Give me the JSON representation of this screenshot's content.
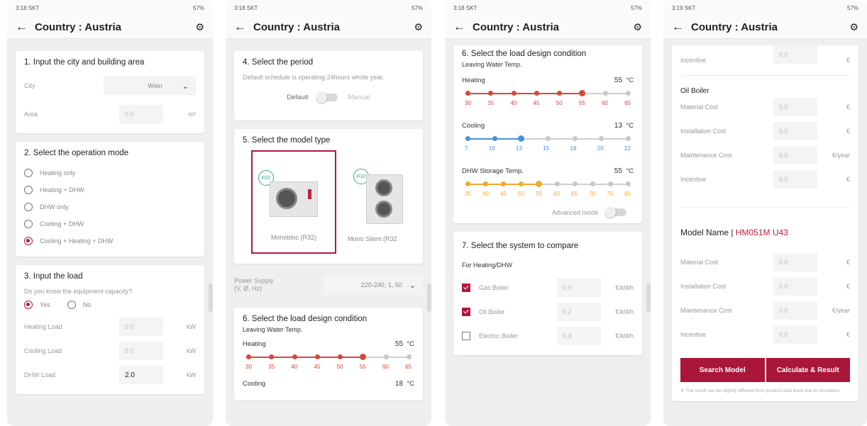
{
  "header": {
    "title": "Country : Austria"
  },
  "status": {
    "s1": "3:18 SKT",
    "s2": "3:18 SKT",
    "s3": "3:18 SKT",
    "s4": "3:19 SKT",
    "right": "57%"
  },
  "p1": {
    "sec1": {
      "title": "1. Input the city and building area",
      "city_label": "City",
      "city_value": "Wien",
      "area_label": "Area",
      "area_value": "0.0",
      "area_unit": "m²"
    },
    "sec2": {
      "title": "2. Select the operation mode",
      "options": [
        "Heating only",
        "Heating + DHW",
        "DHW only",
        "Cooling + DHW",
        "Cooling + Heating + DHW"
      ]
    },
    "sec3": {
      "title": "3. Input the load",
      "question": "Do you know the equipment capacity?",
      "yes": "Yes",
      "no": "No",
      "heating_label": "Heating Load",
      "heating_value": "0.0",
      "unit": "kW",
      "cooling_label": "Cooling Load",
      "cooling_value": "0.0",
      "dhw_label": "DHW Load",
      "dhw_value": "2.0"
    }
  },
  "p2": {
    "sec4": {
      "title": "4. Select the period",
      "desc": "Default schedule is operating 24hours whole year.",
      "default": "Default",
      "manual": "Manual"
    },
    "sec5": {
      "title": "5. Select the model type",
      "badge": "R32",
      "model1": "Monobloc (R32)",
      "model2": "Mono Silent (R32",
      "power_label1": "Power Supply",
      "power_label2": "(V, Ø, Hz)",
      "power_value": "220-240, 1, 50"
    },
    "sec6": {
      "title": "6. Select the load design condition",
      "sub": "Leaving Water Temp.",
      "heating": "Heating",
      "heating_val": "55",
      "unit": "°C",
      "cooling": "Cooling",
      "cooling_val": "18"
    }
  },
  "p3": {
    "sec6": {
      "title": "6. Select the load design condition",
      "sub": "Leaving Water Temp.",
      "heating": "Heating",
      "heating_val": "55",
      "cooling": "Cooling",
      "cooling_val": "13",
      "dhw": "DHW Storage Temp.",
      "dhw_val": "55",
      "unit": "°C",
      "advanced": "Advanced mode"
    },
    "heat_ticks": [
      "30",
      "35",
      "40",
      "45",
      "50",
      "55",
      "60",
      "65"
    ],
    "cool_ticks": [
      "7",
      "10",
      "13",
      "15",
      "18",
      "20",
      "22"
    ],
    "dhw_ticks": [
      "35",
      "40",
      "45",
      "50",
      "55",
      "60",
      "65",
      "70",
      "75",
      "80"
    ],
    "sec7": {
      "title": "7. Select the system to compare",
      "sub": "For Heating/DHW",
      "items": [
        {
          "label": "Gas Boiler",
          "value": "0.0",
          "unit": "€/kWh"
        },
        {
          "label": "Oil Boiler",
          "value": "0.2",
          "unit": "€/kWh"
        },
        {
          "label": "Electric Boiler",
          "value": "0.3",
          "unit": "€/kWh"
        }
      ]
    }
  },
  "p4": {
    "top_incentive": {
      "label": "Incentive",
      "value": "0.0",
      "unit": "€"
    },
    "oil": {
      "title": "Oil Boiler",
      "rows": [
        {
          "label": "Material Cost",
          "value": "0.0",
          "unit": "€"
        },
        {
          "label": "Installation Cost",
          "value": "0.0",
          "unit": "€"
        },
        {
          "label": "Maintenance Cost",
          "value": "0.0",
          "unit": "€/year"
        },
        {
          "label": "Incentive",
          "value": "0.0",
          "unit": "€"
        }
      ]
    },
    "model": {
      "prefix": "Model Name |",
      "name": "HM051M U43",
      "rows": [
        {
          "label": "Material Cost",
          "value": "0.0",
          "unit": "€"
        },
        {
          "label": "Installation Cost",
          "value": "0.0",
          "unit": "€"
        },
        {
          "label": "Maintenance Cost",
          "value": "0.0",
          "unit": "€/year"
        },
        {
          "label": "Incentive",
          "value": "0.0",
          "unit": "€"
        }
      ]
    },
    "search_btn": "Search Model",
    "calc_btn": "Calculate & Result",
    "note": "※ The result can be slightly different from product data book due to simulation."
  },
  "colors": {
    "accent": "#b0183b",
    "heat": "#d9473b",
    "cool": "#4a90d9",
    "dhw": "#f0a830"
  }
}
